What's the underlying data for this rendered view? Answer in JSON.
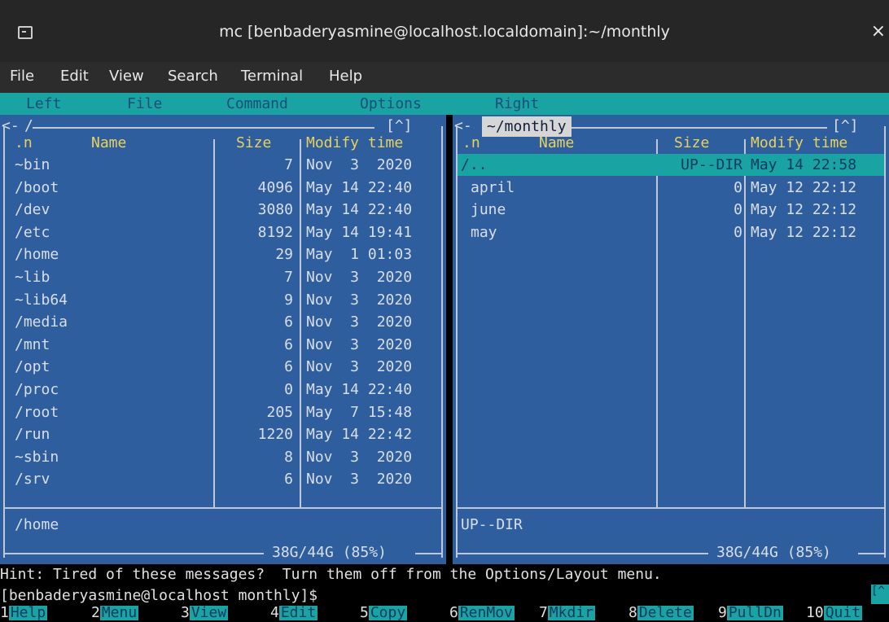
{
  "window": {
    "title": "mc [benbaderyasmine@localhost.localdomain]:~/monthly",
    "close": "×"
  },
  "menubar": [
    "File",
    "Edit",
    "View",
    "Search",
    "Terminal",
    "Help"
  ],
  "mc_menu": [
    "Left",
    "File",
    "Command",
    "Options",
    "Right"
  ],
  "left_panel": {
    "path": "/",
    "corner": "[^]",
    "headers": {
      "n": ".n",
      "name": "Name",
      "size": "Size",
      "mtime": "Modify time"
    },
    "rows": [
      {
        "name": "~bin",
        "size": "7",
        "mtime": "Nov  3  2020"
      },
      {
        "name": "/boot",
        "size": "4096",
        "mtime": "May 14 22:40"
      },
      {
        "name": "/dev",
        "size": "3080",
        "mtime": "May 14 22:40"
      },
      {
        "name": "/etc",
        "size": "8192",
        "mtime": "May 14 19:41"
      },
      {
        "name": "/home",
        "size": "29",
        "mtime": "May  1 01:03"
      },
      {
        "name": "~lib",
        "size": "7",
        "mtime": "Nov  3  2020"
      },
      {
        "name": "~lib64",
        "size": "9",
        "mtime": "Nov  3  2020"
      },
      {
        "name": "/media",
        "size": "6",
        "mtime": "Nov  3  2020"
      },
      {
        "name": "/mnt",
        "size": "6",
        "mtime": "Nov  3  2020"
      },
      {
        "name": "/opt",
        "size": "6",
        "mtime": "Nov  3  2020"
      },
      {
        "name": "/proc",
        "size": "0",
        "mtime": "May 14 22:40"
      },
      {
        "name": "/root",
        "size": "205",
        "mtime": "May  7 15:48"
      },
      {
        "name": "/run",
        "size": "1220",
        "mtime": "May 14 22:42"
      },
      {
        "name": "~sbin",
        "size": "8",
        "mtime": "Nov  3  2020"
      },
      {
        "name": "/srv",
        "size": "6",
        "mtime": "Nov  3  2020"
      }
    ],
    "status": "/home",
    "disk": "38G/44G (85%)"
  },
  "right_panel": {
    "path": "~/monthly",
    "corner": "[^]",
    "headers": {
      "n": ".n",
      "name": "Name",
      "size": "Size",
      "mtime": "Modify time"
    },
    "rows": [
      {
        "name": "/..",
        "size": "UP--DIR",
        "mtime": "May 14 22:58"
      },
      {
        "name": "april",
        "size": "0",
        "mtime": "May 12 22:12"
      },
      {
        "name": "june",
        "size": "0",
        "mtime": "May 12 22:12"
      },
      {
        "name": "may",
        "size": "0",
        "mtime": "May 12 22:12"
      }
    ],
    "status": "UP--DIR",
    "disk": "38G/44G (85%)"
  },
  "hint": "Hint: Tired of these messages?  Turn them off from the Options/Layout menu.",
  "prompt": "[benbaderyasmine@localhost monthly]$",
  "fkeys": [
    {
      "num": "1",
      "label": "Help"
    },
    {
      "num": "2",
      "label": "Menu"
    },
    {
      "num": "3",
      "label": "View"
    },
    {
      "num": "4",
      "label": "Edit"
    },
    {
      "num": "5",
      "label": "Copy"
    },
    {
      "num": "6",
      "label": "RenMov"
    },
    {
      "num": "7",
      "label": "Mkdir"
    },
    {
      "num": "8",
      "label": "Delete"
    },
    {
      "num": "9",
      "label": "PullDn"
    },
    {
      "num": "10",
      "label": "Quit"
    }
  ],
  "colors": {
    "panel": "#2f5e9e",
    "accent": "#1aa3a3",
    "header": "#e8d25a"
  }
}
